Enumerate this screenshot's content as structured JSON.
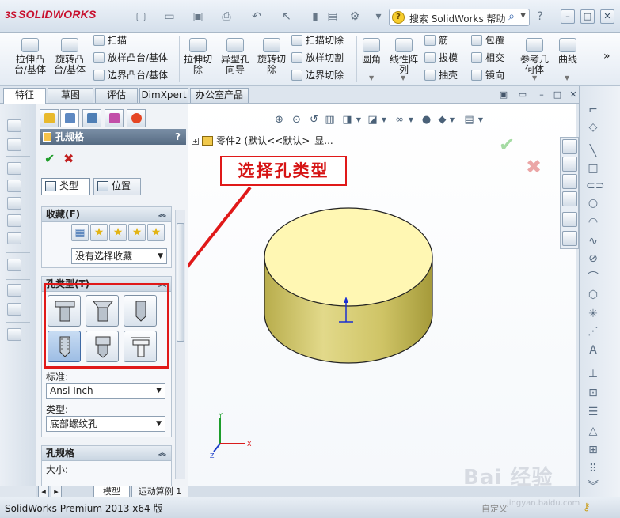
{
  "app": {
    "logo_prefix": "3S",
    "logo_text": "SOLIDWORKS"
  },
  "titlebar": {
    "search_placeholder": "搜索 SolidWorks 帮助",
    "help_glyph": "?"
  },
  "ribbon": {
    "groups": [
      {
        "label": "拉伸凸\n台/基体"
      },
      {
        "label": "旋转凸\n台/基体"
      },
      {
        "label": "拉伸切\n除"
      },
      {
        "label": "异型孔\n向导"
      },
      {
        "label": "旋转切\n除"
      },
      {
        "label": "圆角"
      },
      {
        "label": "线性阵\n列"
      },
      {
        "label": "参考几\n何体"
      },
      {
        "label": "曲线"
      }
    ],
    "small_items": [
      {
        "label": "扫描"
      },
      {
        "label": "放样凸台/基体"
      },
      {
        "label": "边界凸台/基体"
      },
      {
        "label": "扫描切除"
      },
      {
        "label": "放样切割"
      },
      {
        "label": "边界切除"
      },
      {
        "label": "筋"
      },
      {
        "label": "拔模"
      },
      {
        "label": "抽壳"
      },
      {
        "label": "包覆"
      },
      {
        "label": "相交"
      },
      {
        "label": "镜向"
      }
    ],
    "more": "»"
  },
  "tabs": [
    {
      "label": "特征"
    },
    {
      "label": "草图"
    },
    {
      "label": "评估"
    },
    {
      "label": "DimXpert"
    },
    {
      "label": "办公室产品"
    }
  ],
  "property_manager": {
    "title": "孔规格",
    "help": "?",
    "ok_glyph": "✔",
    "cancel_glyph": "✖",
    "subtabs": [
      {
        "label": "类型"
      },
      {
        "label": "位置"
      }
    ],
    "favorites": {
      "header": "收藏(F)",
      "selected": "没有选择收藏"
    },
    "hole_type": {
      "header": "孔类型(T)",
      "standard_label": "标准:",
      "standard_value": "Ansi Inch",
      "type_label": "类型:",
      "type_value": "底部螺纹孔"
    },
    "hole_spec": {
      "header": "孔规格",
      "size_label": "大小:"
    }
  },
  "viewport": {
    "tree_text": "零件2  (默认<<默认>_显...",
    "annotation": "选择孔类型"
  },
  "bottom_tabs": [
    {
      "label": "模型"
    },
    {
      "label": "运动算例 1"
    }
  ],
  "status": {
    "text": "SolidWorks Premium 2013 x64 版",
    "unit": "自定义"
  },
  "watermark": {
    "main": "Bai 经验",
    "sub": "jingyan.baidu.com"
  },
  "colors": {
    "annotation_red": "#e01919",
    "cylinder_fill": "#d9d27a",
    "cylinder_top": "#fff8b8",
    "ok_green": "#1f9d2a",
    "cancel_red": "#c11e1e"
  }
}
